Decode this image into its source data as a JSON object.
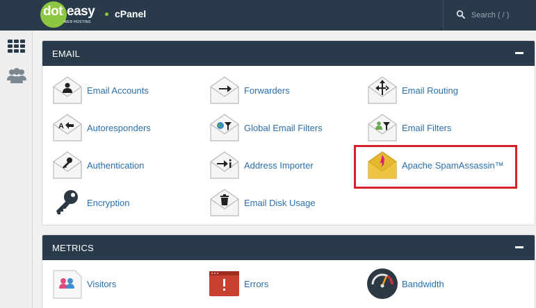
{
  "header": {
    "logo_main": "dot",
    "logo_accent": "easy",
    "logo_sub": "WEB HOSTING",
    "app_name": "cPanel",
    "search_placeholder": "Search ( / )"
  },
  "sidebar": {
    "items": [
      {
        "icon": "grid-icon"
      },
      {
        "icon": "users-icon"
      }
    ]
  },
  "sections": {
    "email": {
      "title": "EMAIL",
      "items": [
        {
          "label": "Email Accounts",
          "icon": "email-accounts-icon"
        },
        {
          "label": "Forwarders",
          "icon": "forwarders-icon"
        },
        {
          "label": "Email Routing",
          "icon": "email-routing-icon"
        },
        {
          "label": "Autoresponders",
          "icon": "autoresponders-icon"
        },
        {
          "label": "Global Email Filters",
          "icon": "global-email-filters-icon"
        },
        {
          "label": "Email Filters",
          "icon": "email-filters-icon"
        },
        {
          "label": "Authentication",
          "icon": "authentication-icon"
        },
        {
          "label": "Address Importer",
          "icon": "address-importer-icon"
        },
        {
          "label": "Apache SpamAssassin™",
          "icon": "spamassassin-icon"
        },
        {
          "label": "Encryption",
          "icon": "encryption-key-icon"
        },
        {
          "label": "Email Disk Usage",
          "icon": "email-disk-usage-icon"
        }
      ]
    },
    "metrics": {
      "title": "METRICS",
      "items": [
        {
          "label": "Visitors",
          "icon": "visitors-icon"
        },
        {
          "label": "Errors",
          "icon": "errors-icon"
        },
        {
          "label": "Bandwidth",
          "icon": "bandwidth-gauge-icon"
        }
      ]
    }
  },
  "colors": {
    "topbar": "#293a4a",
    "brand_green": "#8dc63f",
    "link": "#2a6faa",
    "highlight": "#d5202a"
  }
}
